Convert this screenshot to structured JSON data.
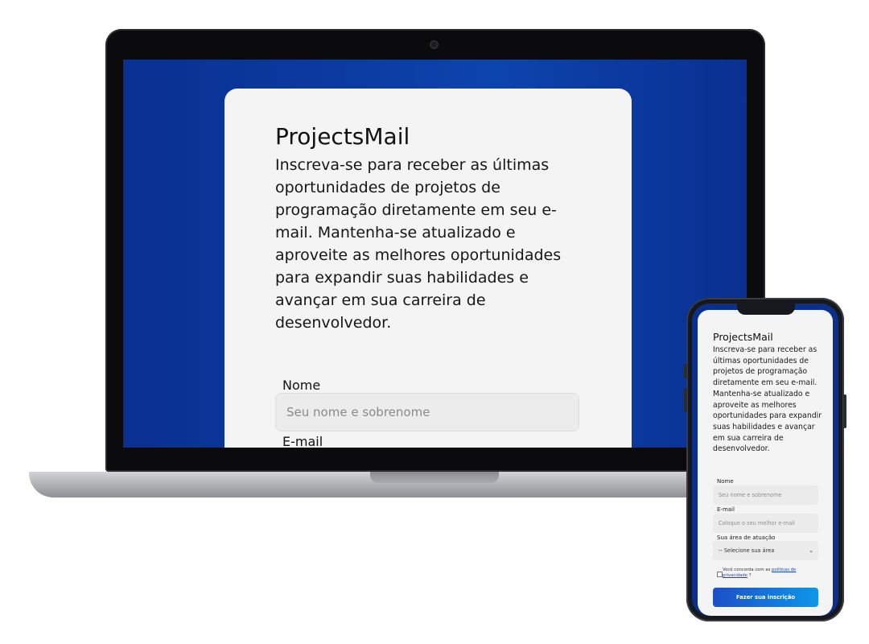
{
  "brand": "ProjectsMail",
  "description": "Inscreva-se para receber as últimas oportunidades de projetos de programação diretamente em seu e-mail. Mantenha-se atualizado e aproveite as melhores oportunidades para expandir suas habilidades e avançar em sua carreira de desenvolvedor.",
  "form": {
    "name_label": "Nome",
    "name_placeholder": "Seu nome e sobrenome",
    "email_label": "E-mail",
    "email_placeholder": "Coloque o seu melhor e-mail",
    "area_label": "Sua área de atuação",
    "area_selected": "-- Selecione sua área",
    "consent_text": "Você concorda com as",
    "consent_link": "politicas de privacidade",
    "consent_suffix": "?",
    "submit_label": "Fazer sua inscrição"
  },
  "colors": {
    "screen_background": "#0b3aa0",
    "card_background": "#f4f4f4",
    "button_gradient_start": "#1c4ec8",
    "button_gradient_end": "#0d97e8"
  },
  "icons": {
    "select_chevron": "chevron-down-icon"
  }
}
